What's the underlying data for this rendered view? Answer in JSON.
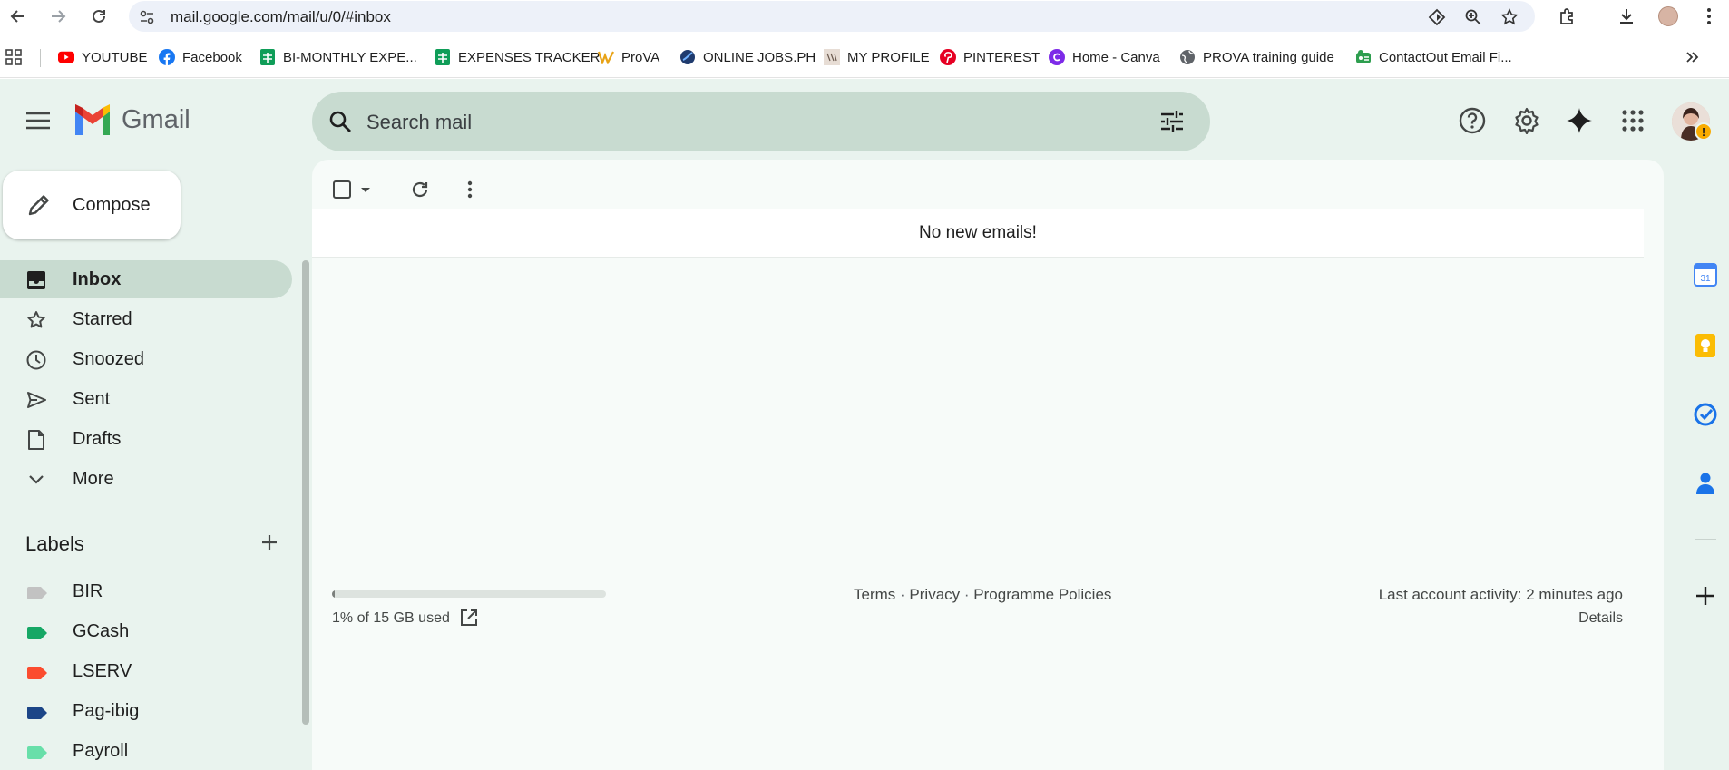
{
  "browser": {
    "url": "mail.google.com/mail/u/0/#inbox",
    "bookmarks": [
      {
        "label": "YOUTUBE",
        "icon": "youtube-icon"
      },
      {
        "label": "Facebook",
        "icon": "facebook-icon"
      },
      {
        "label": "BI-MONTHLY EXPE...",
        "icon": "sheets-icon"
      },
      {
        "label": "EXPENSES TRACKER",
        "icon": "sheets-icon"
      },
      {
        "label": "ProVA",
        "icon": "prova-icon"
      },
      {
        "label": "ONLINE JOBS.PH",
        "icon": "onlinejobs-icon"
      },
      {
        "label": "MY PROFILE",
        "icon": "profile-icon"
      },
      {
        "label": "PINTEREST",
        "icon": "pinterest-icon"
      },
      {
        "label": "Home - Canva",
        "icon": "canva-icon"
      },
      {
        "label": "PROVA training guide",
        "icon": "globe-icon"
      },
      {
        "label": "ContactOut Email Fi...",
        "icon": "contactout-icon"
      }
    ]
  },
  "gmail": {
    "logo_text": "Gmail",
    "search_placeholder": "Search mail",
    "compose_label": "Compose",
    "nav": [
      {
        "label": "Inbox",
        "icon": "inbox-icon",
        "active": true
      },
      {
        "label": "Starred",
        "icon": "star-icon",
        "active": false
      },
      {
        "label": "Snoozed",
        "icon": "clock-icon",
        "active": false
      },
      {
        "label": "Sent",
        "icon": "send-icon",
        "active": false
      },
      {
        "label": "Drafts",
        "icon": "draft-icon",
        "active": false
      },
      {
        "label": "More",
        "icon": "chevron-down-icon",
        "active": false
      }
    ],
    "labels_heading": "Labels",
    "labels": [
      {
        "label": "BIR",
        "color": "#c2c2c2"
      },
      {
        "label": "GCash",
        "color": "#16a765"
      },
      {
        "label": "LSERV",
        "color": "#fb4c2f"
      },
      {
        "label": "Pag-ibig",
        "color": "#1c4587"
      },
      {
        "label": "Payroll",
        "color": "#68dfa9"
      }
    ],
    "empty_message": "No new emails!",
    "storage": {
      "used_text": "1% of 15 GB used",
      "used_fraction": 0.01
    },
    "footer": {
      "terms": "Terms",
      "privacy": "Privacy",
      "policies": "Programme Policies",
      "separator": "·",
      "activity": "Last account activity: 2 minutes ago",
      "details": "Details"
    },
    "colors": {
      "app_bg": "#e9f3ee",
      "active_bg": "#c8dbd0",
      "main_bg": "#f7fbf9"
    }
  }
}
